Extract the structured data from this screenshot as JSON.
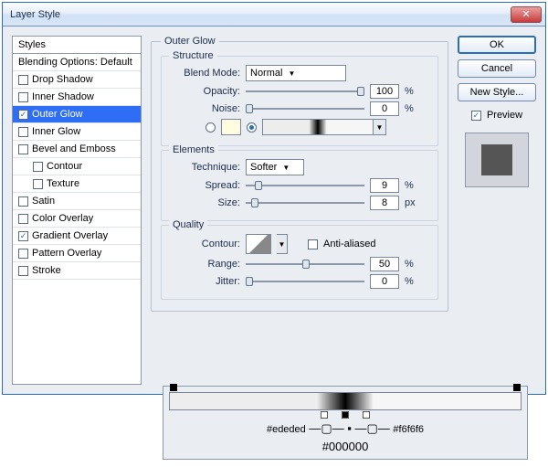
{
  "dialog": {
    "title": "Layer Style"
  },
  "styles": {
    "header": "Styles",
    "blending": "Blending Options: Default",
    "items": [
      {
        "label": "Drop Shadow",
        "checked": false,
        "indent": false
      },
      {
        "label": "Inner Shadow",
        "checked": false,
        "indent": false
      },
      {
        "label": "Outer Glow",
        "checked": true,
        "selected": true,
        "indent": false
      },
      {
        "label": "Inner Glow",
        "checked": false,
        "indent": false
      },
      {
        "label": "Bevel and Emboss",
        "checked": false,
        "indent": false
      },
      {
        "label": "Contour",
        "checked": false,
        "indent": true
      },
      {
        "label": "Texture",
        "checked": false,
        "indent": true
      },
      {
        "label": "Satin",
        "checked": false,
        "indent": false
      },
      {
        "label": "Color Overlay",
        "checked": false,
        "indent": false
      },
      {
        "label": "Gradient Overlay",
        "checked": true,
        "indent": false
      },
      {
        "label": "Pattern Overlay",
        "checked": false,
        "indent": false
      },
      {
        "label": "Stroke",
        "checked": false,
        "indent": false
      }
    ]
  },
  "group_title": "Outer Glow",
  "structure": {
    "title": "Structure",
    "blend_mode_label": "Blend Mode:",
    "blend_mode": "Normal",
    "opacity_label": "Opacity:",
    "opacity": "100",
    "noise_label": "Noise:",
    "noise": "0",
    "pct": "%"
  },
  "elements": {
    "title": "Elements",
    "technique_label": "Technique:",
    "technique": "Softer",
    "spread_label": "Spread:",
    "spread": "9",
    "pct": "%",
    "size_label": "Size:",
    "size": "8",
    "px": "px"
  },
  "quality": {
    "title": "Quality",
    "contour_label": "Contour:",
    "aa_label": "Anti-aliased",
    "range_label": "Range:",
    "range": "50",
    "jitter_label": "Jitter:",
    "jitter": "0",
    "pct": "%"
  },
  "buttons": {
    "ok": "OK",
    "cancel": "Cancel",
    "new_style": "New Style...",
    "preview": "Preview"
  },
  "gradient_annotation": {
    "left": "#ededed",
    "right": "#f6f6f6",
    "center": "#000000"
  }
}
